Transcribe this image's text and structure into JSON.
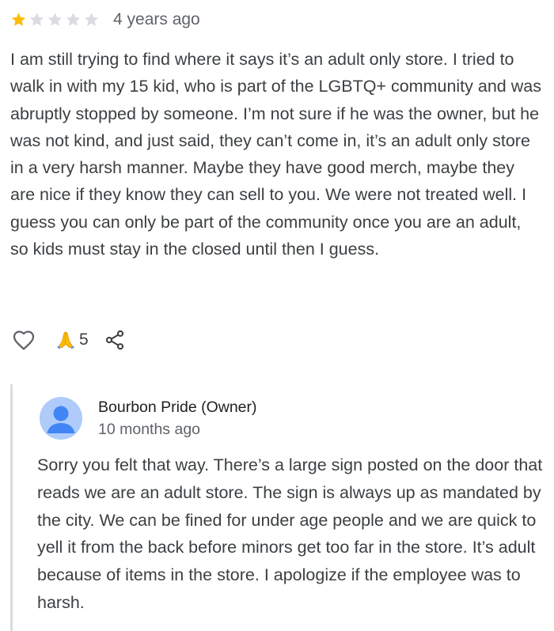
{
  "review": {
    "rating": 1,
    "max_rating": 5,
    "time": "4 years ago",
    "text": "I am still trying to find where it says it’s an adult only store. I tried to walk in with my 15 kid, who is part of the LGBTQ+ community and was abruptly stopped by someone. I’m not sure if he was the owner, but he was not kind, and just said, they can’t come in, it’s an adult only store in a very harsh manner. Maybe they have good merch, maybe they are nice if they know they can sell to you. We were not treated well. I guess you can only be part of the community once you are an adult, so kids must stay in the closed until then I guess.",
    "reaction_count": "5",
    "icons": {
      "like": "heart-outline-icon",
      "reaction": "folded-hands-emoji",
      "share": "share-icon"
    },
    "colors": {
      "star_filled": "#fbbc04",
      "star_empty": "#dadce0"
    }
  },
  "owner_reply": {
    "name": "Bourbon Pride (Owner)",
    "time": "10 months ago",
    "text": "Sorry you felt that way. There’s a large sign posted on the door that reads we are an adult store. The sign is always up as mandated by the city. We can be fined for under age people and we are quick to yell it from the back before minors get too far in the store. It’s adult because of items in the store. I apologize if the employee was to harsh.",
    "avatar": "default-person-avatar",
    "colors": {
      "avatar_bg": "#aecbfa",
      "avatar_fg": "#4285f4"
    }
  }
}
